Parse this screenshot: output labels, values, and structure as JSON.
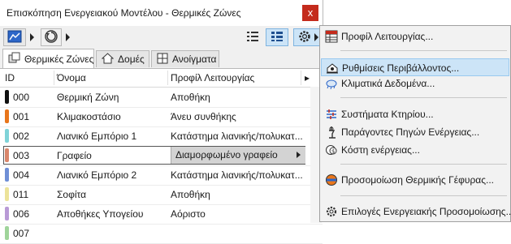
{
  "window": {
    "title": "Επισκόπηση Ενεργειακού Μοντέλου - Θερμικές Ζώνες",
    "close_glyph": "x"
  },
  "tabs": [
    {
      "label": "Θερμικές Ζώνες",
      "icon": "thermal-zones-icon"
    },
    {
      "label": "Δομές",
      "icon": "house-icon"
    },
    {
      "label": "Ανοίγματα",
      "icon": "window-pane-icon"
    }
  ],
  "table": {
    "headers": {
      "id": "ID",
      "name": "Όνομα",
      "profile": "Προφίλ Λειτουργίας"
    },
    "rows": [
      {
        "id": "000",
        "name": "Θερμική Ζώνη",
        "profile": "Αποθήκη",
        "color": "#111111"
      },
      {
        "id": "001",
        "name": "Κλιμακοστάσιο",
        "profile": "Άνευ συνθήκης",
        "color": "#e8761c"
      },
      {
        "id": "002",
        "name": "Λιανικό Εμπόριο 1",
        "profile": "Κατάστημα λιανικής/πολυκατ...",
        "color": "#7fd3d8"
      },
      {
        "id": "003",
        "name": "Γραφείο",
        "profile": "Διαμορφωμένο γραφείο",
        "color": "#d9866b"
      },
      {
        "id": "004",
        "name": "Λιανικό Εμπόριο 2",
        "profile": "Κατάστημα λιανικής/πολυκατ...",
        "color": "#6f8fd6"
      },
      {
        "id": "011",
        "name": "Σοφίτα",
        "profile": "Αποθήκη",
        "color": "#ece39a"
      },
      {
        "id": "006",
        "name": "Αποθήκες Υπογείου",
        "profile": "Αόριστο",
        "color": "#b99ad6"
      },
      {
        "id": "007",
        "name": "",
        "profile": "",
        "color": "#9fd49a"
      }
    ],
    "selected_row_index": 3
  },
  "menu": {
    "items": [
      {
        "label": "Προφίλ Λειτουργίας...",
        "icon": "grid-table-icon"
      },
      {
        "label": "Ρυθμίσεις Περιβάλλοντος...",
        "icon": "environment-settings-icon",
        "highlighted": true
      },
      {
        "label": "Κλιματικά Δεδομένα...",
        "icon": "climate-data-icon"
      },
      {
        "label": "Συστήματα Κτηρίου...",
        "icon": "building-systems-icon"
      },
      {
        "label": "Παράγοντες Πηγών Ενέργειας...",
        "icon": "energy-source-icon"
      },
      {
        "label": "Κόστη ενέργειας...",
        "icon": "energy-cost-icon"
      },
      {
        "label": "Προσομοίωση Θερμικής Γέφυρας...",
        "icon": "thermal-bridge-icon"
      },
      {
        "label": "Επιλογές Ενεργειακής Προσομοίωσης...",
        "icon": "gear-icon"
      }
    ]
  },
  "colors": {
    "accent_red": "#c42b1c",
    "menu_highlight": "#cce4f7"
  }
}
